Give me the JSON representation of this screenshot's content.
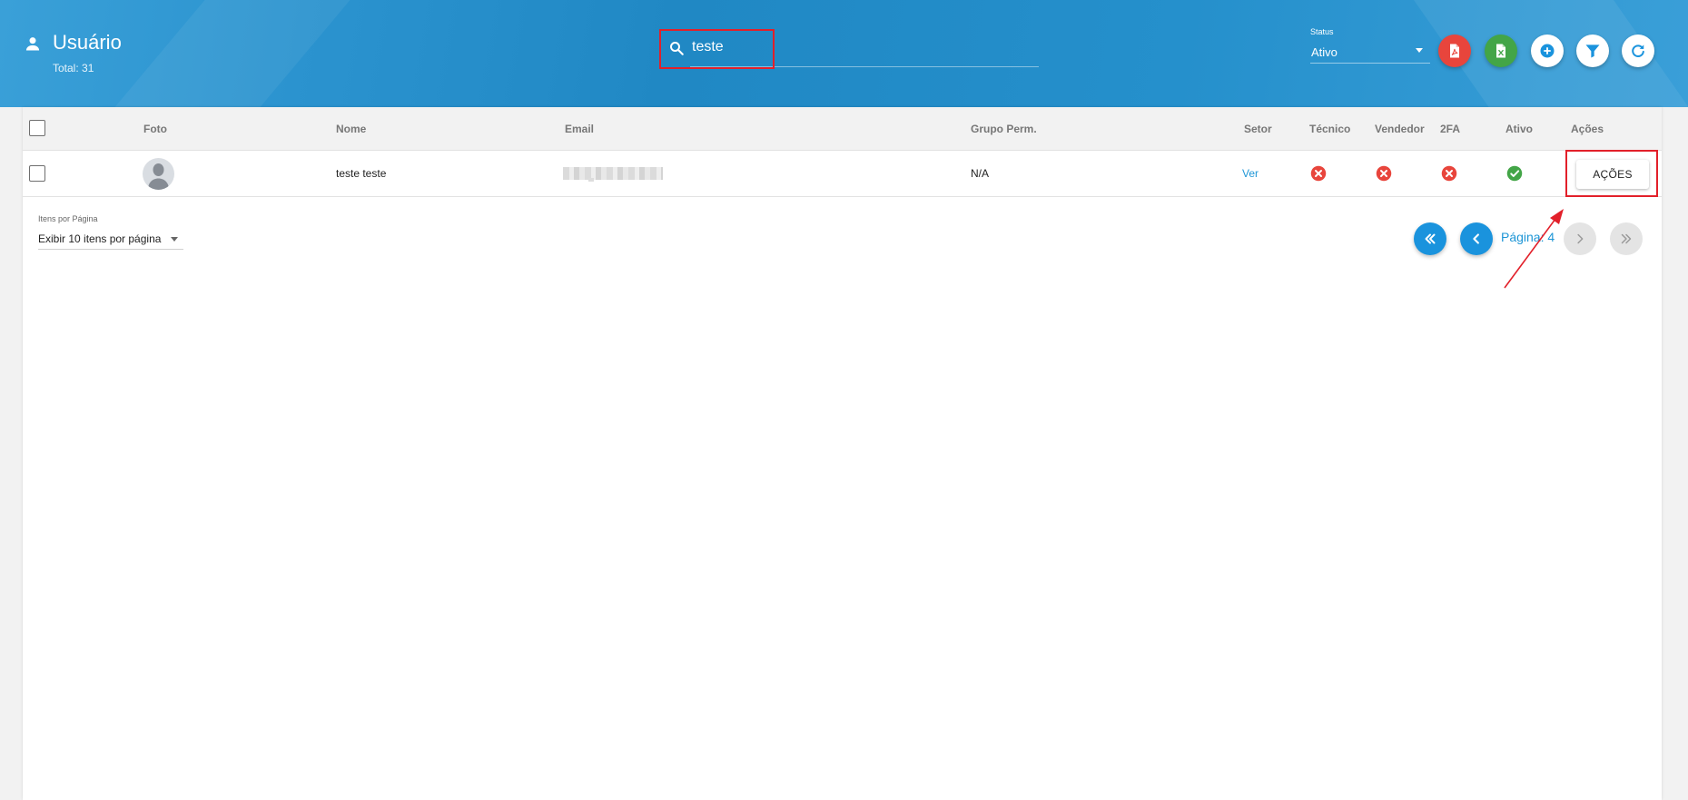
{
  "header": {
    "title": "Usuário",
    "total": "Total: 31",
    "search": {
      "value": "teste",
      "placeholder": ""
    },
    "status_filter": {
      "label": "Status",
      "value": "Ativo"
    },
    "actions": [
      {
        "name": "pdf-export-button",
        "icon": "pdf-icon",
        "color": "#e8453c"
      },
      {
        "name": "excel-export-button",
        "icon": "excel-icon",
        "color": "#43a547"
      },
      {
        "name": "add-button",
        "icon": "plus-circle-icon",
        "color": "#ffffff"
      },
      {
        "name": "filter-button",
        "icon": "filter-icon",
        "color": "#ffffff"
      },
      {
        "name": "refresh-button",
        "icon": "refresh-icon",
        "color": "#ffffff"
      }
    ]
  },
  "table": {
    "columns": [
      "Foto",
      "Nome",
      "Email",
      "Grupo Perm.",
      "Setor",
      "Técnico",
      "Vendedor",
      "2FA",
      "Ativo",
      "Ações"
    ],
    "rows": [
      {
        "nome": "teste teste",
        "email_visible": false,
        "grupo_perm": "N/A",
        "setor": "Ver",
        "tecnico": false,
        "vendedor": false,
        "twofa": false,
        "ativo": true,
        "acoes_label": "AÇÕES"
      }
    ]
  },
  "pagination": {
    "items_per_page_label": "Itens por Página",
    "items_per_page_value": "Exibir 10 itens por página",
    "page_label": "Página: 4"
  },
  "colors": {
    "header_blue": "#2088c4",
    "accent": "#1a93dd",
    "error": "#e8453c",
    "success": "#43a547",
    "highlight": "#e2202a"
  }
}
